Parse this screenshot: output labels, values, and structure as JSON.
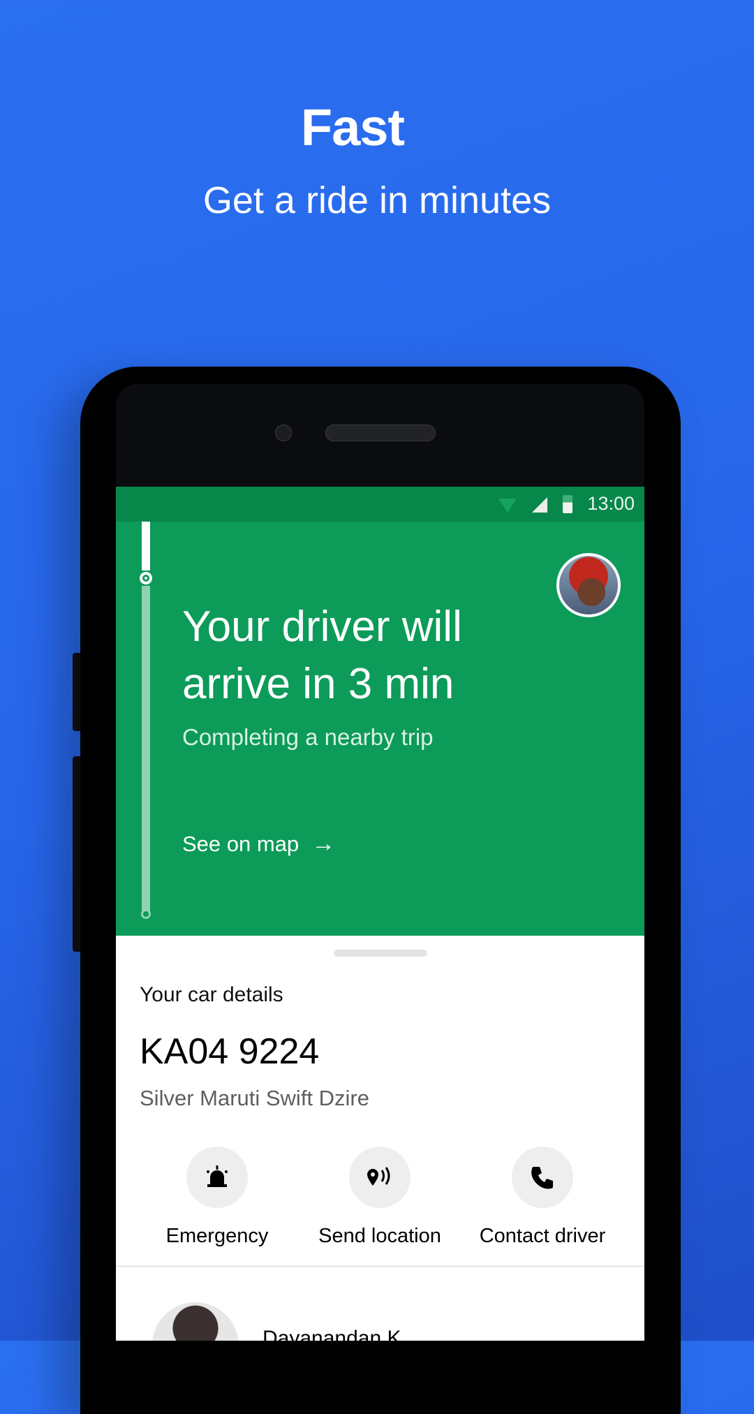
{
  "promo": {
    "title": "Fast",
    "subtitle": "Get a ride in minutes"
  },
  "status_bar": {
    "time": "13:00",
    "icons": [
      "wifi-icon",
      "cell-signal-icon",
      "battery-icon"
    ]
  },
  "trip_status": {
    "headline": "Your driver will arrive in 3 min",
    "subtitle": "Completing a nearby trip",
    "map_link": "See on map",
    "map_link_icon": "arrow-right-icon"
  },
  "car_details": {
    "label": "Your car details",
    "plate": "KA04 9224",
    "model": "Silver Maruti Swift Dzire"
  },
  "actions": [
    {
      "label": "Emergency",
      "icon": "siren-icon"
    },
    {
      "label": "Send location",
      "icon": "location-share-icon"
    },
    {
      "label": "Contact driver",
      "icon": "phone-icon"
    }
  ],
  "driver": {
    "name": "Dayanandan K."
  },
  "colors": {
    "background": "#2a6ff0",
    "hero_green": "#0c9b59",
    "status_bar_green": "#08874b"
  }
}
